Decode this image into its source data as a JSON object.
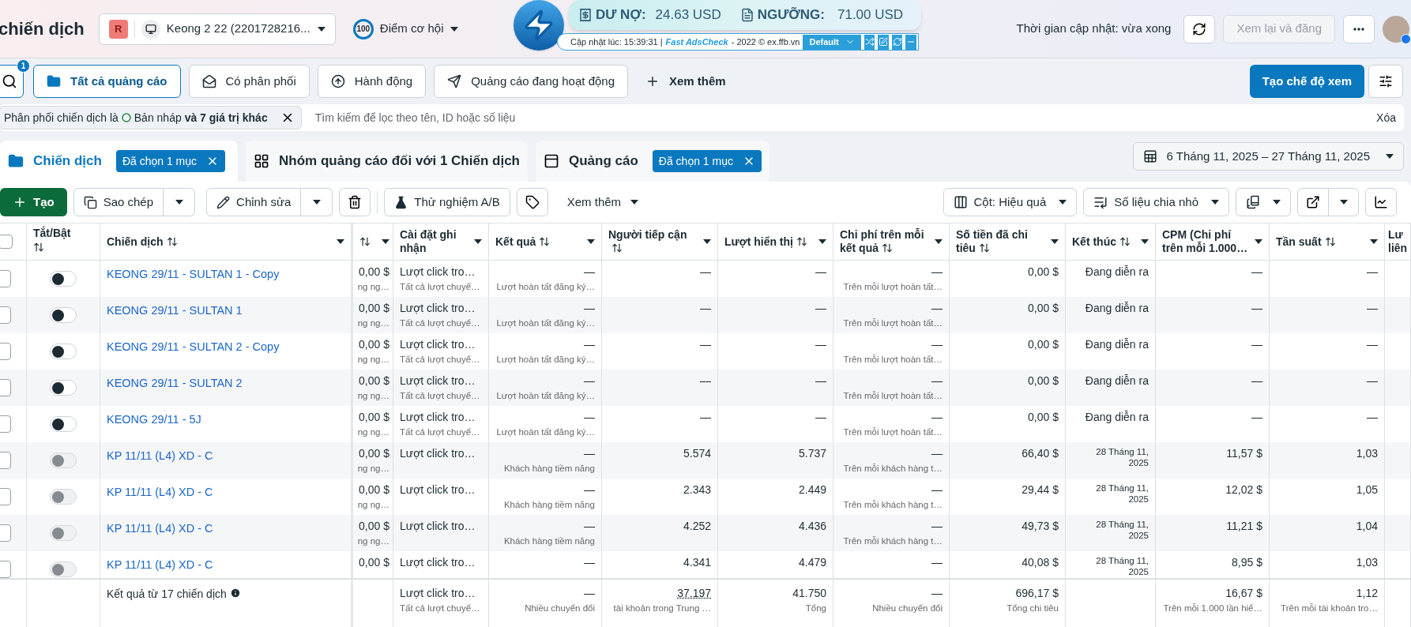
{
  "header": {
    "title": "chiến dịch",
    "account": {
      "badge": "R",
      "name": "Keong 2 22 (2201728216..."
    },
    "score": {
      "value": "100",
      "label": "Điểm cơ hội"
    },
    "update_time": "Thời gian cập nhật: vừa xong",
    "review_button": {
      "label": "Xem lại và đăng",
      "disabled": true
    }
  },
  "extension": {
    "debt_label": "DƯ NỢ:",
    "debt_value": "24.63 USD",
    "threshold_label": "NGƯỠNG:",
    "threshold_value": "71.00 USD",
    "updated": "Cập nhật lúc: 15:39:31 |",
    "brand": "Fast AdsCheck",
    "copyright": "- 2022 © ex.ffb.vn",
    "preset": "Default"
  },
  "search_badge": "1",
  "views": [
    {
      "label": "Tất cả quảng cáo",
      "kind": "folder",
      "selected": true
    },
    {
      "label": "Có phân phối",
      "kind": "mail",
      "selected": false
    },
    {
      "label": "Hành động",
      "kind": "action",
      "selected": false
    },
    {
      "label": "Quảng cáo đang hoạt động",
      "kind": "send",
      "selected": false
    }
  ],
  "more_views": "Xem thêm",
  "create_view": "Tạo chế độ xem",
  "filter": {
    "prefix": "Phân phối chiến dịch là",
    "value": "Bản nháp **và 7 giá trị khác**",
    "search_placeholder": "Tìm kiếm để lọc theo tên, ID hoặc số liệu",
    "clear": "Xóa"
  },
  "level_tabs": [
    {
      "label": "Chiến dịch",
      "kind": "campaign",
      "selected": true,
      "chip": "Đã chọn 1 mục"
    },
    {
      "label": "Nhóm quảng cáo đối với 1 Chiến dịch",
      "kind": "adset",
      "selected": false
    },
    {
      "label": "Quảng cáo",
      "kind": "ad",
      "selected": false,
      "chip": "Đã chọn 1 mục"
    }
  ],
  "date_range": "6 Tháng 11, 2025 – 27 Tháng 11, 2025",
  "toolbar": {
    "create": "Tạo",
    "copy": "Sao chép",
    "edit": "Chỉnh sửa",
    "ab_test": "Thử nghiệm A/B",
    "more": "Xem thêm",
    "columns": "Cột: Hiệu quả",
    "breakdown": "Số liệu chia nhỏ"
  },
  "table": {
    "header_checked": false,
    "toggle_header": "Tắt/Bật",
    "name_header": "Chiến dịch",
    "columns": [
      {
        "kind": "number",
        "sortable": true,
        "menu": true
      },
      {
        "label": "Cài đặt ghi nhận",
        "kind": "text",
        "sortable": false,
        "menu": true
      },
      {
        "label": "Kết quả",
        "kind": "number",
        "sortable": true,
        "menu": true
      },
      {
        "label": "Người tiếp cận",
        "kind": "number",
        "sortable": true,
        "menu": true
      },
      {
        "label": "Lượt hiển thị",
        "kind": "number",
        "sortable": true,
        "menu": true
      },
      {
        "label": "Chi phí trên mỗi kết quả",
        "kind": "number",
        "sortable": true,
        "menu": true
      },
      {
        "label": "Số tiền đã chi tiêu",
        "kind": "number",
        "sortable": true,
        "menu": true
      },
      {
        "label": "Kết thúc",
        "kind": "number",
        "sortable": true,
        "menu": true
      },
      {
        "label": "CPM (Chi phí trên mỗi 1.000…",
        "kind": "number",
        "sortable": false,
        "menu": true
      },
      {
        "label": "Tần suất",
        "kind": "number",
        "sortable": true,
        "menu": true
      },
      {
        "label": "Lư liên",
        "kind": "text"
      }
    ],
    "rows": [
      {
        "checked": false,
        "disabled": false,
        "name": "KEONG 29/11 - SULTAN 1 - Copy",
        "cells": [
          {
            "main": "0,00 $",
            "sub": "ng ng…"
          },
          {
            "main": "Lượt click tro…",
            "sub": "Tất cả lượt chuyể…"
          },
          {
            "main": "—",
            "sub": "Lượt hoàn tất đăng ký…"
          },
          {
            "main": "—"
          },
          {
            "main": "—"
          },
          {
            "main": "—",
            "sub": "Trên mỗi lượt hoàn tất…"
          },
          {
            "main": "0,00 $"
          },
          {
            "main": "Đang diễn ra"
          },
          {
            "main": "—"
          },
          {
            "main": "—"
          }
        ]
      },
      {
        "checked": false,
        "disabled": false,
        "name": "KEONG 29/11 - SULTAN 1",
        "cells": [
          {
            "main": "0,00 $",
            "sub": "ng ng…"
          },
          {
            "main": "Lượt click tro…",
            "sub": "Tất cả lượt chuyể…"
          },
          {
            "main": "—",
            "sub": "Lượt hoàn tất đăng ký…"
          },
          {
            "main": "—"
          },
          {
            "main": "—"
          },
          {
            "main": "—",
            "sub": "Trên mỗi lượt hoàn tất…"
          },
          {
            "main": "0,00 $"
          },
          {
            "main": "Đang diễn ra"
          },
          {
            "main": "—"
          },
          {
            "main": "—"
          }
        ]
      },
      {
        "checked": false,
        "disabled": false,
        "name": "KEONG 29/11 - SULTAN 2 - Copy",
        "cells": [
          {
            "main": "0,00 $",
            "sub": "ng ng…"
          },
          {
            "main": "Lượt click tro…",
            "sub": "Tất cả lượt chuyể…"
          },
          {
            "main": "—",
            "sub": "Lượt hoàn tất đăng ký…"
          },
          {
            "main": "—"
          },
          {
            "main": "—"
          },
          {
            "main": "—",
            "sub": "Trên mỗi lượt hoàn tất…"
          },
          {
            "main": "0,00 $"
          },
          {
            "main": "Đang diễn ra"
          },
          {
            "main": "—"
          },
          {
            "main": "—"
          }
        ]
      },
      {
        "checked": false,
        "disabled": false,
        "name": "KEONG 29/11 - SULTAN 2",
        "cells": [
          {
            "main": "0,00 $",
            "sub": "ng ng…"
          },
          {
            "main": "Lượt click tro…",
            "sub": "Tất cả lượt chuyể…"
          },
          {
            "main": "—",
            "sub": "Lượt hoàn tất đăng ký…"
          },
          {
            "main": "—"
          },
          {
            "main": "—"
          },
          {
            "main": "—",
            "sub": "Trên mỗi lượt hoàn tất…"
          },
          {
            "main": "0,00 $"
          },
          {
            "main": "Đang diễn ra"
          },
          {
            "main": "—"
          },
          {
            "main": "—"
          }
        ]
      },
      {
        "checked": false,
        "disabled": false,
        "name": "KEONG 29/11 - 5J",
        "cells": [
          {
            "main": "0,00 $",
            "sub": "ng ng…"
          },
          {
            "main": "Lượt click tro…",
            "sub": "Tất cả lượt chuyể…"
          },
          {
            "main": "—",
            "sub": "Lượt hoàn tất đăng ký…"
          },
          {
            "main": "—"
          },
          {
            "main": "—"
          },
          {
            "main": "—",
            "sub": "Trên mỗi lượt hoàn tất…"
          },
          {
            "main": "0,00 $"
          },
          {
            "main": "Đang diễn ra"
          },
          {
            "main": "—"
          },
          {
            "main": "—"
          }
        ]
      },
      {
        "checked": false,
        "disabled": true,
        "name": "KP 11/11 (L4) XD - C",
        "cells": [
          {
            "main": "0,00 $",
            "sub": "ng ng…"
          },
          {
            "main": "Lượt click tro…"
          },
          {
            "main": "—",
            "sub": "Khách hàng tiềm năng"
          },
          {
            "main": "5.574"
          },
          {
            "main": "5.737"
          },
          {
            "main": "—",
            "sub": "Trên mỗi khách hàng t…"
          },
          {
            "main": "66,40 $"
          },
          {
            "main": "28 Tháng 11, 2025",
            "kind": "date"
          },
          {
            "main": "11,57 $"
          },
          {
            "main": "1,03"
          }
        ]
      },
      {
        "checked": false,
        "disabled": true,
        "name": "KP 11/11 (L4) XD - C",
        "cells": [
          {
            "main": "0,00 $",
            "sub": "ng ng…"
          },
          {
            "main": "Lượt click tro…"
          },
          {
            "main": "—",
            "sub": "Khách hàng tiềm năng"
          },
          {
            "main": "2.343"
          },
          {
            "main": "2.449"
          },
          {
            "main": "—",
            "sub": "Trên mỗi khách hàng t…"
          },
          {
            "main": "29,44 $"
          },
          {
            "main": "28 Tháng 11, 2025",
            "kind": "date"
          },
          {
            "main": "12,02 $"
          },
          {
            "main": "1,05"
          }
        ]
      },
      {
        "checked": false,
        "disabled": true,
        "name": "KP 11/11 (L4) XD - C",
        "cells": [
          {
            "main": "0,00 $",
            "sub": "ng ng…"
          },
          {
            "main": "Lượt click tro…"
          },
          {
            "main": "—",
            "sub": "Khách hàng tiềm năng"
          },
          {
            "main": "4.252"
          },
          {
            "main": "4.436"
          },
          {
            "main": "—",
            "sub": "Trên mỗi khách hàng t…"
          },
          {
            "main": "49,73 $"
          },
          {
            "main": "28 Tháng 11, 2025",
            "kind": "date"
          },
          {
            "main": "11,21 $"
          },
          {
            "main": "1,04"
          }
        ]
      },
      {
        "checked": false,
        "disabled": true,
        "name": "KP 11/11 (L4) XD - C",
        "cells": [
          {
            "main": "0,00 $"
          },
          {
            "main": "Lượt click tro…"
          },
          {
            "main": "—"
          },
          {
            "main": "4.341"
          },
          {
            "main": "4.479"
          },
          {
            "main": "—"
          },
          {
            "main": "40,08 $"
          },
          {
            "main": "28 Tháng 11, 2025",
            "kind": "date"
          },
          {
            "main": "8,95 $"
          },
          {
            "main": "1,03"
          }
        ]
      }
    ],
    "footer": {
      "label": "Kết quả từ 17 chiến dịch",
      "cells": [
        null,
        {
          "main": "Lượt click tro…",
          "sub": "Tất cả lượt chuyể…"
        },
        {
          "main": "—",
          "sub": "Nhiều chuyển đổi"
        },
        {
          "main": "37.197",
          "sub": "tài khoản trong Trung …",
          "kind": "dotted"
        },
        {
          "main": "41.750",
          "sub": "Tổng"
        },
        {
          "main": "—",
          "sub": "Nhiều chuyển đổi"
        },
        {
          "main": "696,17 $",
          "sub": "Tổng chi tiêu"
        },
        null,
        {
          "main": "16,67 $",
          "sub": "Trên mỗi 1.000 lần hiể…"
        },
        {
          "main": "1,12",
          "sub": "Trên mỗi tài khoản tro…"
        }
      ]
    }
  }
}
